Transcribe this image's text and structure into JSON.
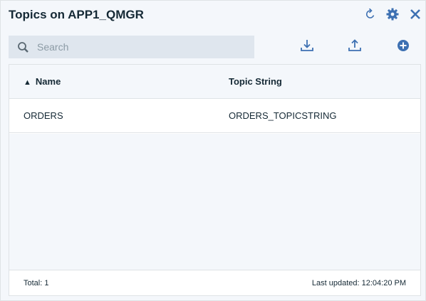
{
  "header": {
    "title": "Topics on APP1_QMGR",
    "icons": [
      "refresh-icon",
      "gear-icon",
      "close-icon"
    ],
    "accent_color": "#3d70b2"
  },
  "toolbar": {
    "search_placeholder": "Search",
    "icons": [
      "download-icon",
      "upload-icon",
      "add-icon"
    ]
  },
  "table": {
    "columns": [
      "Name",
      "Topic String"
    ],
    "sort_indicator": "▲",
    "rows": [
      {
        "name": "ORDERS",
        "topic_string": "ORDERS_TOPICSTRING"
      }
    ]
  },
  "footer": {
    "total_label": "Total: 1",
    "last_updated_label": "Last updated: 12:04:20 PM"
  }
}
